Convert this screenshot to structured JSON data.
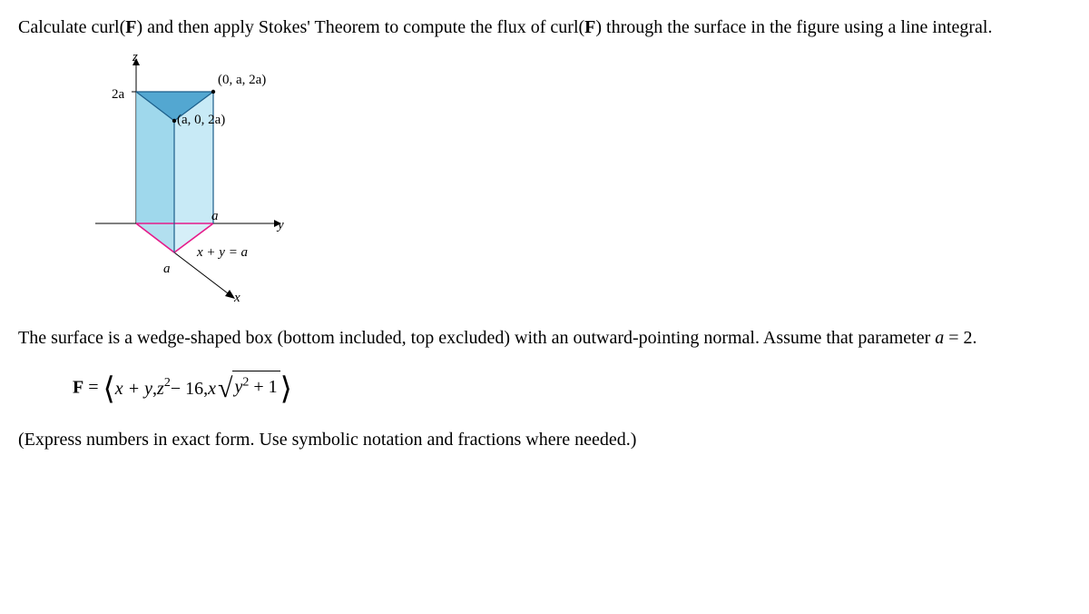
{
  "problem_intro_1": "Calculate curl(",
  "F": "F",
  "problem_intro_2": ") and then apply Stokes' Theorem to compute the flux of curl(",
  "problem_intro_3": ") through the surface in the figure using a line integral.",
  "fig": {
    "z": "z",
    "y": "y",
    "x": "x",
    "twoA": "2a",
    "a1": "a",
    "a2": "a",
    "point1": "(0, a, 2a)",
    "point2": "(a, 0, 2a)",
    "line_eq": "x + y = a"
  },
  "surface_desc_1": "The surface is a wedge-shaped box (bottom included, top excluded) with an outward-pointing normal. Assume that parameter ",
  "param_a": "a",
  "surface_desc_2": " = 2.",
  "vec_field": {
    "F": "F",
    "eq": " = ",
    "xpy": "x + y",
    "z": "z",
    "sq": "2",
    "m16": " − 16, ",
    "x": "x",
    "y": "y",
    "ysq": "2",
    "p1": " + 1"
  },
  "instruction": "(Express numbers in exact form. Use symbolic notation and fractions where needed.)"
}
